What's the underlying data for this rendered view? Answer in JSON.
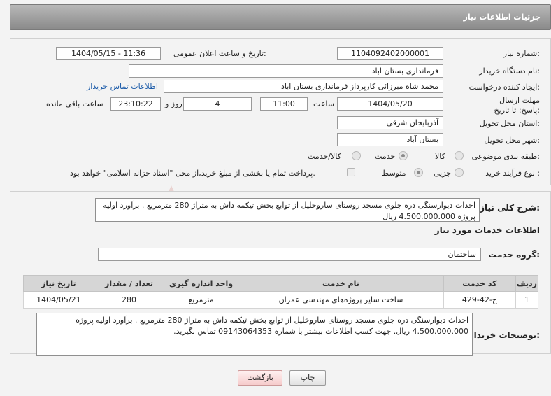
{
  "header": {
    "title": "جزئیات اطلاعات نیاز"
  },
  "form": {
    "need_number_label": "شماره نیاز:",
    "need_number": "1104092402000001",
    "announce_label": "تاریخ و ساعت اعلان عمومی:",
    "announce_value": "1404/05/15 - 11:36",
    "buyer_org_label": "نام دستگاه خریدار:",
    "buyer_org": "فرمانداری بستان اباد",
    "creator_label": "ایجاد کننده درخواست:",
    "creator": "محمد شاه میرزائی کارپرداز فرمانداری بستان اباد",
    "contact_link": "اطلاعات تماس خریدار",
    "deadline_label": "مهلت ارسال پاسخ: تا تاریخ:",
    "deadline_date": "1404/05/20",
    "time_label": "ساعت",
    "deadline_time": "11:00",
    "days_value": "4",
    "days_label": "روز و",
    "remaining_time": "23:10:22",
    "remaining_label": "ساعت باقی مانده",
    "province_label": "استان محل تحویل:",
    "province": "آذربایجان شرقی",
    "city_label": "شهر محل تحویل:",
    "city": "بستان آباد",
    "category_label": "طبقه بندی موضوعی:",
    "category_options": [
      "کالا",
      "خدمت",
      "کالا/خدمت"
    ],
    "category_selected": "خدمت",
    "process_label": "نوع فرآیند خرید :",
    "process_options": [
      "جزیی",
      "متوسط"
    ],
    "process_selected": "متوسط",
    "payment_note": "پرداخت تمام یا بخشی از مبلغ خرید،از محل \"اسناد خزانه اسلامی\" خواهد بود."
  },
  "summary": {
    "label": "شرح کلی نیاز:",
    "text": "احداث دیوارسنگی دره جلوی مسجد روستای ساروخلیل از توابع بخش تیکمه داش به متراژ 280 مترمربع . برآورد اولیه پروژه 4.500.000.000 ریال"
  },
  "services": {
    "section_title": "اطلاعات خدمات مورد نیاز",
    "group_label": "گروه خدمت:",
    "group_value": "ساختمان",
    "columns": [
      "ردیف",
      "کد خدمت",
      "نام خدمت",
      "واحد اندازه گیری",
      "تعداد / مقدار",
      "تاریخ نیاز"
    ],
    "rows": [
      {
        "row": "1",
        "code": "ج-42-429",
        "name": "ساخت سایر پروژه‌های مهندسی عمران",
        "unit": "مترمربع",
        "qty": "280",
        "date": "1404/05/21"
      }
    ]
  },
  "buyer_notes": {
    "label": "توضیحات خریدار:",
    "text": "احداث دیوارسنگی دره جلوی مسجد روستای ساروخلیل از توابع بخش تیکمه داش به متراژ 280 مترمربع . برآورد اولیه پروژه 4.500.000.000 ریال. جهت کسب اطلاعات بیشتر با شماره 09143064353 تماس بگیرید."
  },
  "buttons": {
    "print": "چاپ",
    "back": "بازگشت"
  },
  "watermark": "AriaTender.neT",
  "colors": {
    "header": "#9a9a9a",
    "link": "#1a5aa8",
    "watermark": "#c0392b"
  }
}
